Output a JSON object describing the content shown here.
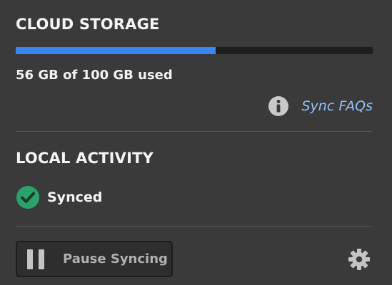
{
  "cloud_storage": {
    "title": "CLOUD STORAGE",
    "used_gb": 56,
    "total_gb": 100,
    "used_fraction": 0.56,
    "usage_text": "56 GB of 100 GB used",
    "faq_link_label": "Sync FAQs",
    "colors": {
      "bar_fill": "#3a85f0",
      "bar_track": "#1f1f1f",
      "link": "#8ec2ff"
    }
  },
  "local_activity": {
    "title": "LOCAL ACTIVITY",
    "status_label": "Synced",
    "status_icon": "check-circle-icon",
    "colors": {
      "status_ok": "#2aa36b"
    }
  },
  "footer": {
    "pause_button_label": "Pause Syncing",
    "pause_icon": "pause-icon",
    "settings_icon": "gear-icon"
  },
  "theme": {
    "background": "#3a3a3a",
    "divider": "#555555"
  }
}
